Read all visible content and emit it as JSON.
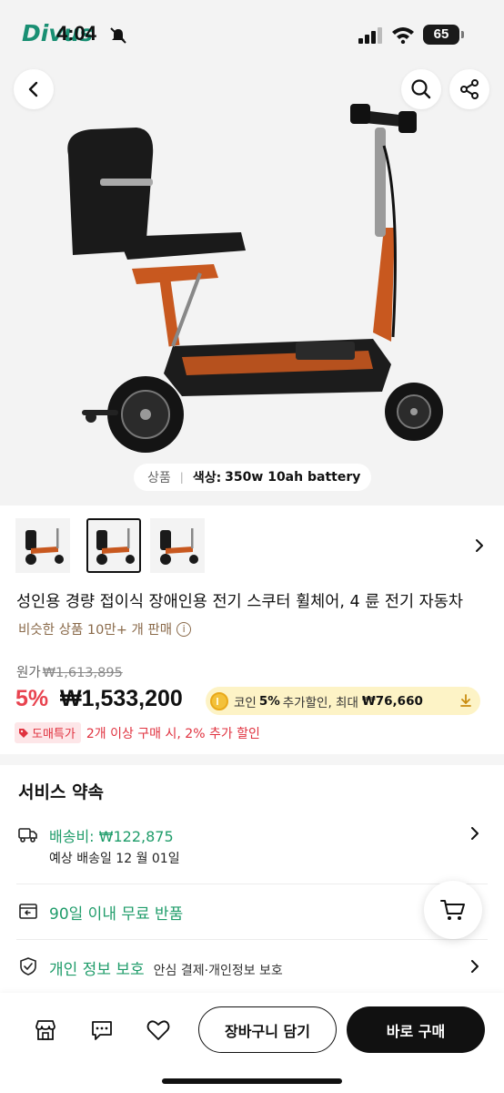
{
  "status_bar": {
    "logo_text": "Divus",
    "time": "4:04",
    "battery": "65"
  },
  "hero": {
    "variant_label": "상품",
    "variant_value_key": "색상:",
    "variant_value": "350w 10ah battery"
  },
  "product": {
    "title": "성인용 경량 접이식 장애인용 전기 스쿠터 휠체어, 4 륜 전기 자동차",
    "similar_sales": "비슷한 상품 10만+ 개 판매",
    "original_label": "원가",
    "original_price": "₩1,613,895",
    "discount": "5%",
    "price": "₩1,533,200",
    "coin": {
      "prefix": "코인",
      "percent": "5%",
      "middle": "추가할인, 최대",
      "max": "₩76,660"
    },
    "promo_badge": "도매특가",
    "promo_text": "2개 이상 구매 시, 2% 추가 할인"
  },
  "service": {
    "heading": "서비스 약속",
    "shipping_fee": "배송비: ₩122,875",
    "delivery_date": "예상 배송일 12 월 01일",
    "returns": "90일 이내 무료 반품",
    "privacy": "개인 정보 보호",
    "privacy_extra": "안심 결제·개인정보 보호"
  },
  "bottom_bar": {
    "add_to_cart": "장바구니 담기",
    "buy_now": "바로 구매"
  },
  "colors": {
    "accent_green": "#1f9c6a",
    "discount_red": "#e8434f",
    "coin_banner_bg": "#fdf3c6",
    "promo_badge_bg": "#fde6e8"
  },
  "icons": [
    "back-icon",
    "search-icon",
    "share-icon",
    "chevron-right-icon",
    "info-icon",
    "coin-icon",
    "download-icon",
    "tag-icon",
    "truck-icon",
    "return-box-icon",
    "shield-icon",
    "cart-icon",
    "store-icon",
    "chat-icon",
    "heart-icon"
  ]
}
